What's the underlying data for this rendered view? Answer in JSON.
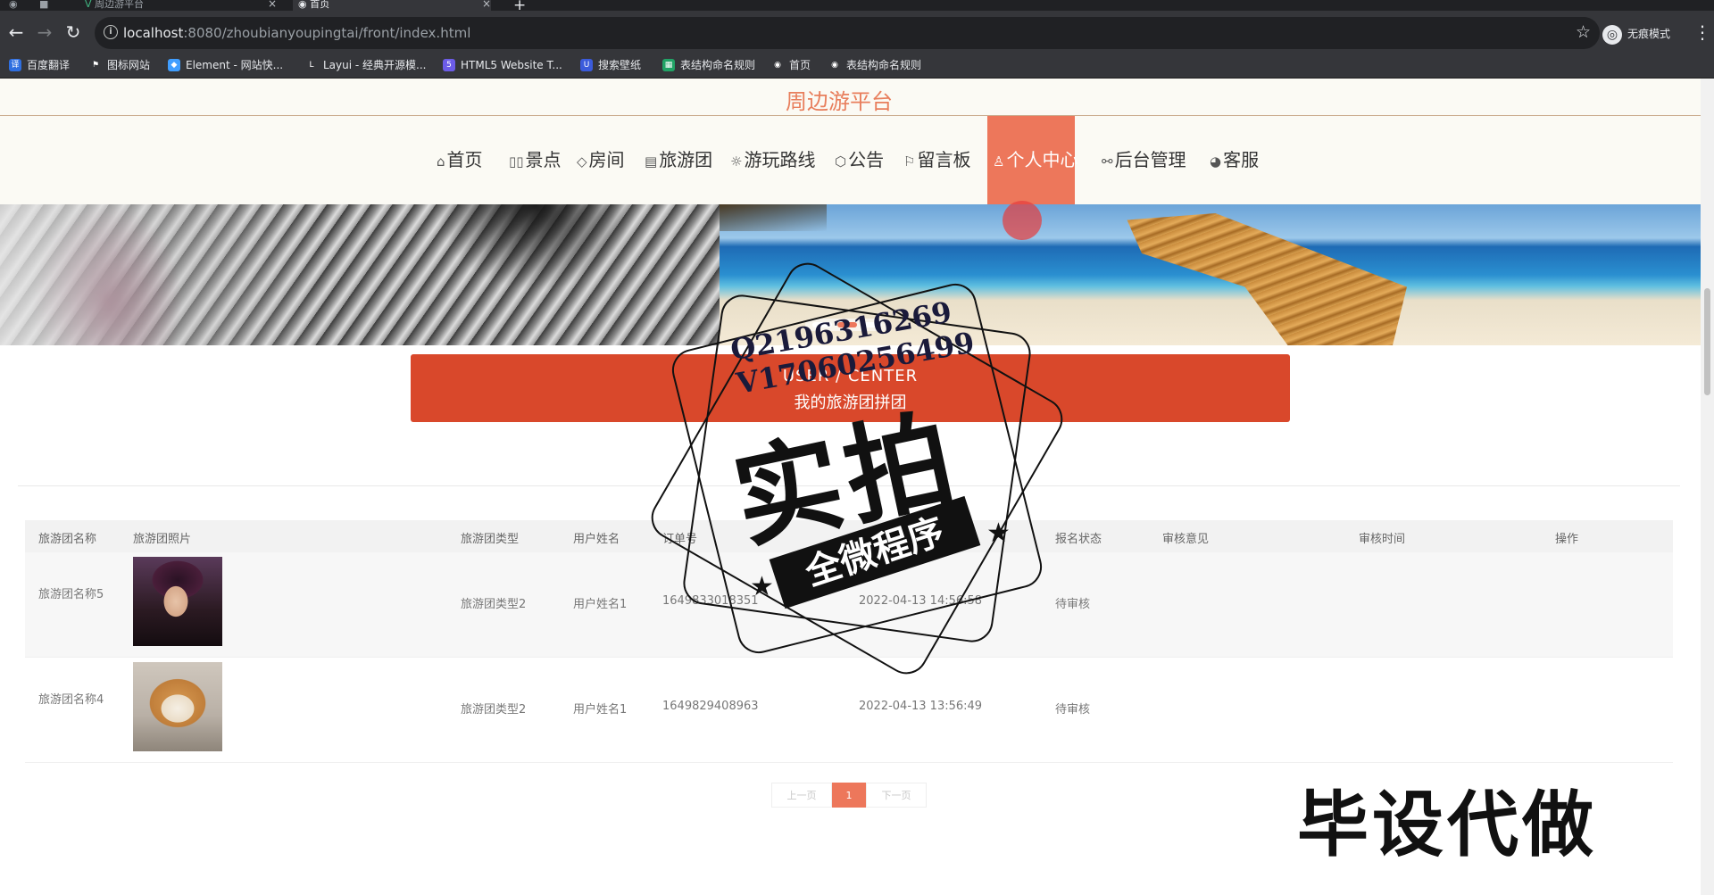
{
  "browser": {
    "tabs": [
      {
        "title": "周边游平台",
        "icon": "vue-logo-icon"
      },
      {
        "title": "首页",
        "icon": "globe-icon"
      }
    ],
    "url_host": "localhost",
    "url_path": ":8080/zhoubianyoupingtai/front/index.html",
    "incognito_label": "无痕模式",
    "bookmarks": [
      "百度翻译",
      "图标网站",
      "Element - 网站快...",
      "Layui - 经典开源模...",
      "HTML5 Website T...",
      "搜索壁纸",
      "表结构命名规则",
      "首页",
      "表结构命名规则"
    ]
  },
  "site": {
    "title": "周边游平台",
    "nav": [
      {
        "label": "首页",
        "icon": "home-icon"
      },
      {
        "label": "景点",
        "icon": "binoculars-icon"
      },
      {
        "label": "房间",
        "icon": "tag-icon"
      },
      {
        "label": "旅游团",
        "icon": "calendar-icon"
      },
      {
        "label": "游玩路线",
        "icon": "sun-icon"
      },
      {
        "label": "公告",
        "icon": "cube-icon"
      },
      {
        "label": "留言板",
        "icon": "flag-icon"
      },
      {
        "label": "个人中心",
        "icon": "user-icon",
        "active": true
      },
      {
        "label": "后台管理",
        "icon": "link-icon"
      },
      {
        "label": "客服",
        "icon": "chat-icon"
      }
    ]
  },
  "section": {
    "title_en": "USER / CENTER",
    "title_zh": "我的旅游团拼团"
  },
  "table": {
    "headers": [
      "旅游团名称",
      "旅游团照片",
      "旅游团类型",
      "用户姓名",
      "订单号",
      "报名时间",
      "报名状态",
      "审核意见",
      "审核时间",
      "操作"
    ],
    "rows": [
      {
        "name": "旅游团名称5",
        "photo": "person-photo",
        "type": "旅游团类型2",
        "user": "用户姓名1",
        "order": "1649833018351",
        "time": "2022-04-13 14:56:58",
        "status": "待审核",
        "opinion": "",
        "review_time": "",
        "action": ""
      },
      {
        "name": "旅游团名称4",
        "photo": "dog-photo",
        "type": "旅游团类型2",
        "user": "用户姓名1",
        "order": "1649829408963",
        "time": "2022-04-13 13:56:49",
        "status": "待审核",
        "opinion": "",
        "review_time": "",
        "action": ""
      }
    ]
  },
  "pagination": {
    "prev": "上一页",
    "current": "1",
    "next": "下一页"
  },
  "watermark": {
    "qq": "Q2196316269",
    "wechat": "V17060256499",
    "stamp_main": "实拍",
    "stamp_ribbon": "全微程序",
    "corner_text": "毕设代做"
  },
  "colors": {
    "accent": "#ed775b",
    "section_bar": "#d9482b",
    "title": "#e87e5c"
  }
}
